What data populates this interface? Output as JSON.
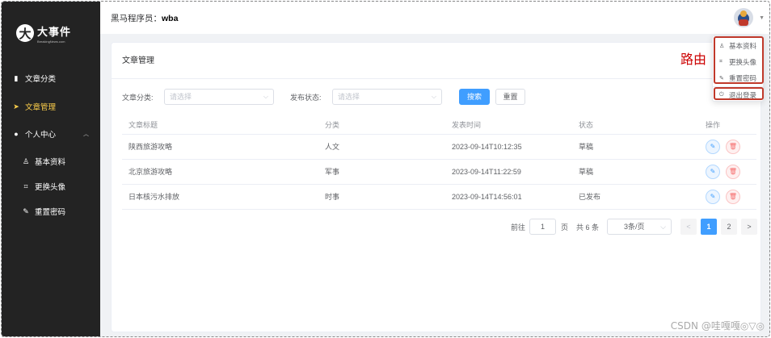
{
  "sidebar": {
    "logo_title": "大事件",
    "logo_sub": "BreakingNews.com",
    "items": [
      {
        "label": "文章分类",
        "icon": "document-icon"
      },
      {
        "label": "文章管理",
        "icon": "paper-plane-icon"
      },
      {
        "label": "个人中心",
        "icon": "user-icon"
      },
      {
        "label": "基本资料",
        "icon": "user-outline-icon"
      },
      {
        "label": "更换头像",
        "icon": "crop-icon"
      },
      {
        "label": "重置密码",
        "icon": "edit-icon"
      }
    ]
  },
  "header": {
    "user_prefix": "黑马程序员：",
    "username": "wba"
  },
  "card": {
    "title": "文章管理",
    "filters": {
      "category_label": "文章分类:",
      "category_placeholder": "请选择",
      "state_label": "发布状态:",
      "state_placeholder": "请选择",
      "search_label": "搜索",
      "reset_label": "重置"
    },
    "table": {
      "columns": [
        "文章标题",
        "分类",
        "发表时间",
        "状态",
        "操作"
      ],
      "rows": [
        {
          "title": "陕西旅游攻略",
          "category": "人文",
          "time": "2023-09-14T10:12:35",
          "state": "草稿"
        },
        {
          "title": "北京旅游攻略",
          "category": "军事",
          "time": "2023-09-14T11:22:59",
          "state": "草稿"
        },
        {
          "title": "日本核污水排放",
          "category": "时事",
          "time": "2023-09-14T14:56:01",
          "state": "已发布"
        }
      ]
    },
    "pagination": {
      "goto_label": "前往",
      "goto_value": "1",
      "page_label": "页",
      "total": "共 6 条",
      "page_size": "3条/页",
      "prev": "<",
      "pages": [
        "1",
        "2"
      ],
      "next": ">"
    }
  },
  "dropdown": {
    "items": [
      {
        "label": "基本资料",
        "icon": "user-outline-icon"
      },
      {
        "label": "更换头像",
        "icon": "crop-icon"
      },
      {
        "label": "重置密码",
        "icon": "edit-icon"
      },
      {
        "label": "退出登录",
        "icon": "power-icon"
      }
    ]
  },
  "annotation": "路由",
  "watermark": "CSDN @哇嘎嘎◎▽◎"
}
